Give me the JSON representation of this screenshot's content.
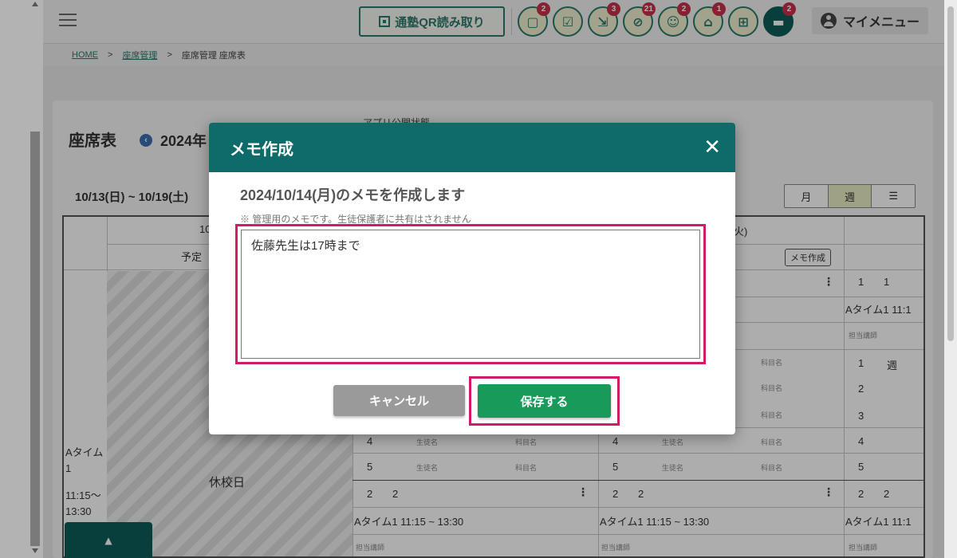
{
  "header": {
    "qr_button": "通塾QR読み取り",
    "icons": [
      {
        "name": "chat-icon",
        "glyph": "▢",
        "badge": "2"
      },
      {
        "name": "checklist-icon",
        "glyph": "☑",
        "badge": ""
      },
      {
        "name": "arrows-in-icon",
        "glyph": "⇲",
        "badge": "3"
      },
      {
        "name": "no-entry-icon",
        "glyph": "⊘",
        "badge": "21"
      },
      {
        "name": "group-icon",
        "glyph": "☺",
        "badge": "2"
      },
      {
        "name": "bank-icon",
        "glyph": "⌂",
        "badge": "1"
      },
      {
        "name": "gift-icon",
        "glyph": "⊞",
        "badge": ""
      },
      {
        "name": "message-icon",
        "glyph": "▬",
        "badge": "2"
      }
    ],
    "my_menu": "マイメニュー"
  },
  "breadcrumb": {
    "home": "HOME",
    "sep": ">",
    "seat_mgmt": "座席管理",
    "current": "座席管理 座席表"
  },
  "page": {
    "title": "座席表",
    "year": "2024年",
    "app_status": "アプリ公開状態",
    "date_range": "10/13(日) ~ 10/19(土)",
    "view_month": "月",
    "view_week": "週",
    "view_list": "☰"
  },
  "grid": {
    "day_header_left": "10/",
    "day_header_right": "火)",
    "planned": "予定",
    "memo_btn": "メモ作成",
    "slot_label": "Aタイム1",
    "slot_time": "11:15～13:30",
    "holiday": "休校日",
    "a_time_row": "Aタイム1 11:15 ~ 13:30",
    "a_time_short": "Aタイム1 11:1",
    "teacher": "担当講師",
    "student": "生徒名",
    "subject": "科目名",
    "week": "週",
    "rows": [
      "1",
      "2",
      "3",
      "4",
      "5"
    ],
    "mini_rows": [
      "4",
      "5"
    ]
  },
  "modal": {
    "title": "メモ作成",
    "close": "✕",
    "subtitle": "2024/10/14(月)のメモを作成します",
    "note": "※ 管理用のメモです。生徒保護者に共有はされません",
    "memo_value": "佐藤先生は17時まで",
    "cancel": "キャンセル",
    "save": "保存する"
  }
}
